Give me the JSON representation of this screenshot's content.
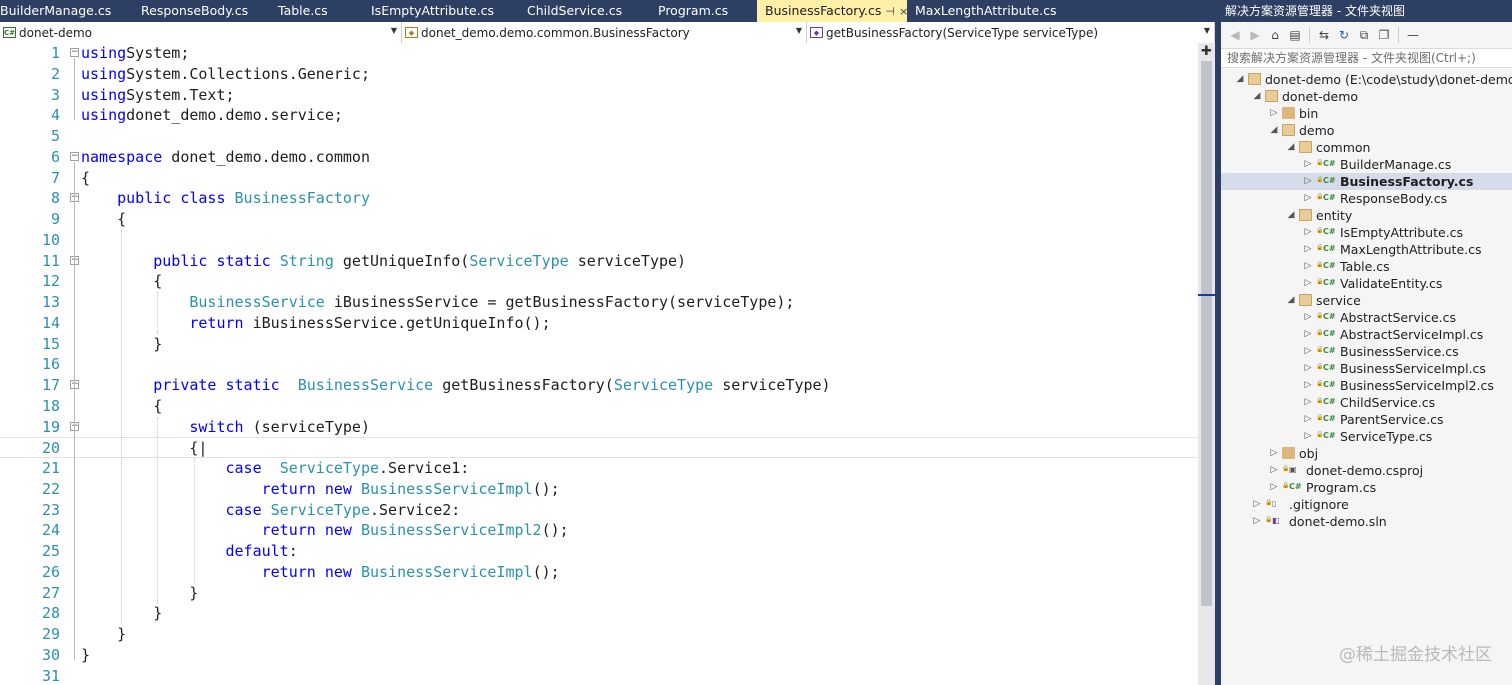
{
  "editor": {
    "tabs": [
      {
        "label": "BuilderManage.cs",
        "active": false
      },
      {
        "label": "ResponseBody.cs",
        "active": false
      },
      {
        "label": "Table.cs",
        "active": false
      },
      {
        "label": "IsEmptyAttribute.cs",
        "active": false
      },
      {
        "label": "ChildService.cs",
        "active": false
      },
      {
        "label": "Program.cs",
        "active": false
      },
      {
        "label": "BusinessFactory.cs",
        "active": true
      },
      {
        "label": "MaxLengthAttribute.cs",
        "active": false
      }
    ],
    "nav": {
      "project": "donet-demo",
      "type": "donet_demo.demo.common.BusinessFactory",
      "member": "getBusinessFactory(ServiceType serviceType)"
    },
    "current_line": 20,
    "lines": [
      {
        "n": "1",
        "fold": "minus",
        "tokens": [
          [
            "kw",
            "using"
          ],
          [
            "",
            "System;"
          ]
        ]
      },
      {
        "n": "2",
        "tokens": [
          [
            "kw",
            "using"
          ],
          [
            "",
            "System.Collections.Generic;"
          ]
        ]
      },
      {
        "n": "3",
        "tokens": [
          [
            "kw",
            "using"
          ],
          [
            "",
            "System.Text;"
          ]
        ]
      },
      {
        "n": "4",
        "tokens": [
          [
            "kw",
            "using"
          ],
          [
            "",
            "donet_demo.demo.service;"
          ]
        ]
      },
      {
        "n": "5",
        "tokens": []
      },
      {
        "n": "6",
        "fold": "minus",
        "tokens": [
          [
            "kw",
            "namespace"
          ],
          [
            "",
            " donet_demo.demo.common"
          ]
        ]
      },
      {
        "n": "7",
        "tokens": [
          [
            "",
            "{"
          ]
        ]
      },
      {
        "n": "8",
        "fold": "minus",
        "tokens": [
          [
            "",
            "    "
          ],
          [
            "kw",
            "public class"
          ],
          [
            "",
            " "
          ],
          [
            "ty",
            "BusinessFactory"
          ]
        ]
      },
      {
        "n": "9",
        "tokens": [
          [
            "",
            "    {"
          ]
        ]
      },
      {
        "n": "10",
        "tokens": []
      },
      {
        "n": "11",
        "fold": "minus",
        "tokens": [
          [
            "",
            "        "
          ],
          [
            "kw",
            "public static"
          ],
          [
            "",
            " "
          ],
          [
            "ty",
            "String"
          ],
          [
            "",
            " getUniqueInfo("
          ],
          [
            "ty",
            "ServiceType"
          ],
          [
            "",
            " serviceType)"
          ]
        ]
      },
      {
        "n": "12",
        "tokens": [
          [
            "",
            "        {"
          ]
        ]
      },
      {
        "n": "13",
        "tokens": [
          [
            "",
            "            "
          ],
          [
            "ty",
            "BusinessService"
          ],
          [
            "",
            " iBusinessService = getBusinessFactory(serviceType);"
          ]
        ]
      },
      {
        "n": "14",
        "tokens": [
          [
            "",
            "            "
          ],
          [
            "kw",
            "return"
          ],
          [
            "",
            " iBusinessService.getUniqueInfo();"
          ]
        ]
      },
      {
        "n": "15",
        "tokens": [
          [
            "",
            "        }"
          ]
        ]
      },
      {
        "n": "16",
        "tokens": []
      },
      {
        "n": "17",
        "fold": "minus",
        "tokens": [
          [
            "",
            "        "
          ],
          [
            "kw",
            "private static"
          ],
          [
            "",
            "  "
          ],
          [
            "ty",
            "BusinessService"
          ],
          [
            "",
            " getBusinessFactory("
          ],
          [
            "ty",
            "ServiceType"
          ],
          [
            "",
            " serviceType)"
          ]
        ]
      },
      {
        "n": "18",
        "tokens": [
          [
            "",
            "        {"
          ]
        ]
      },
      {
        "n": "19",
        "fold": "minus",
        "tokens": [
          [
            "",
            "            "
          ],
          [
            "kw",
            "switch"
          ],
          [
            "",
            " (serviceType)"
          ]
        ]
      },
      {
        "n": "20",
        "tokens": [
          [
            "",
            "            {|"
          ]
        ]
      },
      {
        "n": "21",
        "tokens": [
          [
            "",
            "                "
          ],
          [
            "kw",
            "case"
          ],
          [
            "",
            "  "
          ],
          [
            "ty",
            "ServiceType"
          ],
          [
            "",
            ".Service1:"
          ]
        ]
      },
      {
        "n": "22",
        "tokens": [
          [
            "",
            "                    "
          ],
          [
            "kw",
            "return new"
          ],
          [
            "",
            " "
          ],
          [
            "ty",
            "BusinessServiceImpl"
          ],
          [
            "",
            "();"
          ]
        ]
      },
      {
        "n": "23",
        "tokens": [
          [
            "",
            "                "
          ],
          [
            "kw",
            "case"
          ],
          [
            "",
            " "
          ],
          [
            "ty",
            "ServiceType"
          ],
          [
            "",
            ".Service2:"
          ]
        ]
      },
      {
        "n": "24",
        "tokens": [
          [
            "",
            "                    "
          ],
          [
            "kw",
            "return new"
          ],
          [
            "",
            " "
          ],
          [
            "ty",
            "BusinessServiceImpl2"
          ],
          [
            "",
            "();"
          ]
        ]
      },
      {
        "n": "25",
        "tokens": [
          [
            "",
            "                "
          ],
          [
            "kw",
            "default"
          ],
          [
            "",
            ":"
          ]
        ]
      },
      {
        "n": "26",
        "tokens": [
          [
            "",
            "                    "
          ],
          [
            "kw",
            "return new"
          ],
          [
            "",
            " "
          ],
          [
            "ty",
            "BusinessServiceImpl"
          ],
          [
            "",
            "();"
          ]
        ]
      },
      {
        "n": "27",
        "tokens": [
          [
            "",
            "            }"
          ]
        ]
      },
      {
        "n": "28",
        "tokens": [
          [
            "",
            "        }"
          ]
        ]
      },
      {
        "n": "29",
        "tokens": [
          [
            "",
            "    }"
          ]
        ]
      },
      {
        "n": "30",
        "tokens": [
          [
            "",
            "}"
          ]
        ]
      },
      {
        "n": "31",
        "tokens": []
      }
    ]
  },
  "explorer": {
    "title": "解决方案资源管理器 - 文件夹视图",
    "search_placeholder": "搜索解决方案资源管理器 - 文件夹视图(Ctrl+;)",
    "toolbar_icons": [
      "back-icon",
      "forward-icon",
      "home-icon",
      "view-switch-icon",
      "sync-icon",
      "refresh-icon",
      "collapse-all-icon",
      "show-all-files-icon",
      "properties-icon"
    ],
    "tree": [
      {
        "label": "donet-demo (E:\\code\\study\\donet-demo)",
        "depth": 0,
        "kind": "folder-open",
        "expand": "open"
      },
      {
        "label": "donet-demo",
        "depth": 1,
        "kind": "folder-open",
        "expand": "open"
      },
      {
        "label": "bin",
        "depth": 2,
        "kind": "folder",
        "expand": "closed"
      },
      {
        "label": "demo",
        "depth": 2,
        "kind": "folder-open",
        "expand": "open"
      },
      {
        "label": "common",
        "depth": 3,
        "kind": "folder-open",
        "expand": "open"
      },
      {
        "label": "BuilderManage.cs",
        "depth": 4,
        "kind": "cs",
        "expand": "closed"
      },
      {
        "label": "BusinessFactory.cs",
        "depth": 4,
        "kind": "cs",
        "expand": "closed",
        "selected": true
      },
      {
        "label": "ResponseBody.cs",
        "depth": 4,
        "kind": "cs",
        "expand": "closed"
      },
      {
        "label": "entity",
        "depth": 3,
        "kind": "folder-open",
        "expand": "open"
      },
      {
        "label": "IsEmptyAttribute.cs",
        "depth": 4,
        "kind": "cs",
        "expand": "closed"
      },
      {
        "label": "MaxLengthAttribute.cs",
        "depth": 4,
        "kind": "cs",
        "expand": "closed"
      },
      {
        "label": "Table.cs",
        "depth": 4,
        "kind": "cs",
        "expand": "closed"
      },
      {
        "label": "ValidateEntity.cs",
        "depth": 4,
        "kind": "cs",
        "expand": "closed"
      },
      {
        "label": "service",
        "depth": 3,
        "kind": "folder-open",
        "expand": "open"
      },
      {
        "label": "AbstractService.cs",
        "depth": 4,
        "kind": "cs",
        "expand": "closed"
      },
      {
        "label": "AbstractServiceImpl.cs",
        "depth": 4,
        "kind": "cs",
        "expand": "closed"
      },
      {
        "label": "BusinessService.cs",
        "depth": 4,
        "kind": "cs",
        "expand": "closed"
      },
      {
        "label": "BusinessServiceImpl.cs",
        "depth": 4,
        "kind": "cs",
        "expand": "closed"
      },
      {
        "label": "BusinessServiceImpl2.cs",
        "depth": 4,
        "kind": "cs",
        "expand": "closed"
      },
      {
        "label": "ChildService.cs",
        "depth": 4,
        "kind": "cs",
        "expand": "closed"
      },
      {
        "label": "ParentService.cs",
        "depth": 4,
        "kind": "cs",
        "expand": "closed"
      },
      {
        "label": "ServiceType.cs",
        "depth": 4,
        "kind": "cs",
        "expand": "closed"
      },
      {
        "label": "obj",
        "depth": 2,
        "kind": "folder",
        "expand": "closed"
      },
      {
        "label": "donet-demo.csproj",
        "depth": 2,
        "kind": "csproj",
        "expand": "closed"
      },
      {
        "label": "Program.cs",
        "depth": 2,
        "kind": "cs",
        "expand": "closed"
      },
      {
        "label": ".gitignore",
        "depth": 1,
        "kind": "file",
        "expand": "closed"
      },
      {
        "label": "donet-demo.sln",
        "depth": 1,
        "kind": "sln",
        "expand": "closed"
      }
    ]
  },
  "watermark": "@稀土掘金技术社区",
  "colors": {
    "tabbar": "#2d3f63",
    "active_tab": "#fff0a8",
    "keyword": "#0000ff",
    "type": "#2b91af",
    "line_number": "#2b91af"
  }
}
